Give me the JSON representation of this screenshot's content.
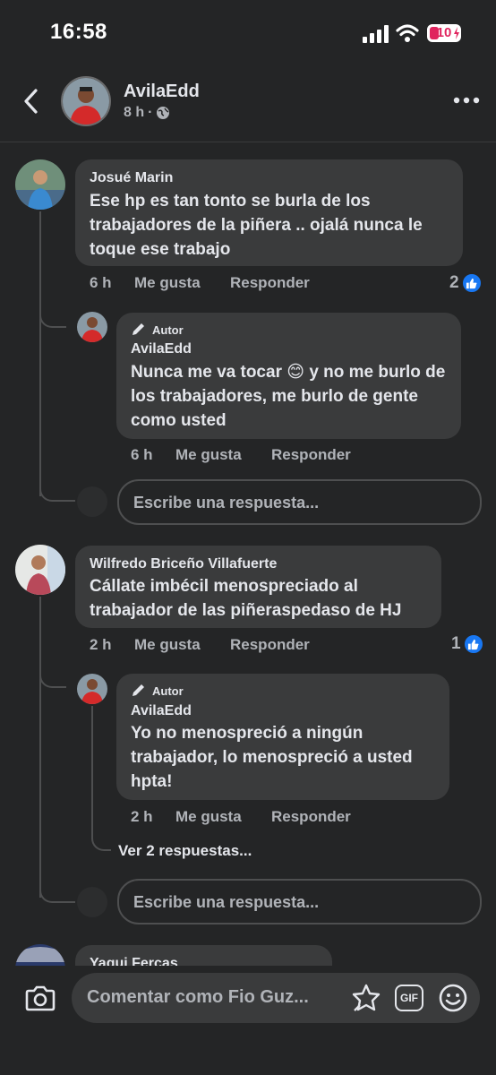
{
  "status_bar": {
    "time": "16:58",
    "battery": "10"
  },
  "header": {
    "author": "AvilaEdd",
    "time": "8 h",
    "separator": "·"
  },
  "comments": [
    {
      "author": "Josué Marin",
      "text": "Ese hp es tan tonto se burla de los trabajadores de la piñera .. ojalá nunca le toque ese trabajo",
      "time": "6 h",
      "like_label": "Me gusta",
      "reply_label": "Responder",
      "reactions": "2",
      "reply": {
        "badge": "Autor",
        "author": "AvilaEdd",
        "text": "Nunca me va tocar 😊 y no me burlo de los trabajadores, me burlo de gente como usted",
        "time": "6 h",
        "like_label": "Me gusta",
        "reply_label": "Responder"
      },
      "reply_placeholder": "Escribe una respuesta..."
    },
    {
      "author": "Wilfredo Briceño Villafuerte",
      "text": "Cállate imbécil menospreciado al trabajador de las piñeraspedaso de HJ",
      "time": "2 h",
      "like_label": "Me gusta",
      "reply_label": "Responder",
      "reactions": "1",
      "reply": {
        "badge": "Autor",
        "author": "AvilaEdd",
        "text": "Yo no menospreció a ningún trabajador, lo menospreció a usted hpta!",
        "time": "2 h",
        "like_label": "Me gusta",
        "reply_label": "Responder"
      },
      "more_replies": "Ver 2 respuestas...",
      "reply_placeholder": "Escribe una respuesta..."
    },
    {
      "author": "Yagui Fercas"
    }
  ],
  "composer": {
    "placeholder": "Comentar como Fio Guz..."
  },
  "icons": {
    "back": "chevron-left-icon",
    "more": "more-icon",
    "globe": "globe-icon",
    "pencil": "pencil-icon",
    "like": "thumbs-up-icon",
    "camera": "camera-icon",
    "sticker": "sticker-icon",
    "gif": "gif-icon",
    "emoji": "smiley-icon"
  },
  "colors": {
    "background": "#242526",
    "bubble": "#3a3b3c",
    "accent": "#1877f2",
    "battery_low": "#e0245e"
  }
}
